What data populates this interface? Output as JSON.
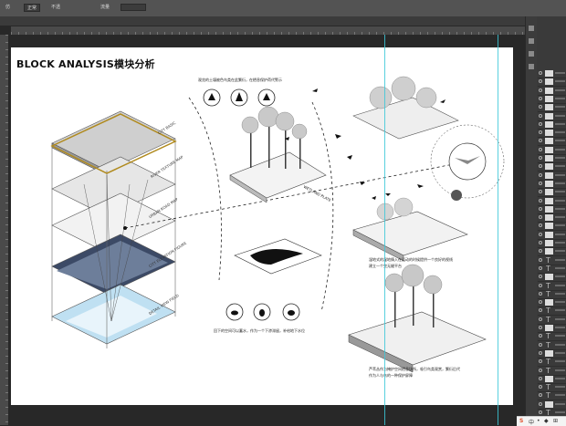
{
  "options_bar": {
    "left_label": "仿",
    "mode_value": "正常",
    "opacity_label": "不透",
    "flow_label": "流量"
  },
  "doc_tab": {
    "title": ""
  },
  "canvas": {
    "title": "BLOCK ANALYSIS模块分析",
    "layer_labels": [
      "CITY BASIC",
      "RIVER TEXTURE MAP",
      "URBAN ROAD MAP",
      "CITY ELEVATION FIGURE",
      "DETAIL VIEW FIELD"
    ],
    "captions": {
      "top": "观览的土壤被色鸟类在此繁衍，在栖息保护荷代警示",
      "wetland": "WETLAND PLATE",
      "middle_left": "回下的空间可以蓄水，作为一个下渗滞留，补给地下水位",
      "right_mid_1": "湿地式的湿地情入在运动的时候提供一个良好的视线",
      "right_mid_2": "建立一个完无缝平台",
      "right_bottom_1": "芦苇丛作为掩护空间栖息场所，吸引鸟类观赏，繁衍后代",
      "right_bottom_2": "作为人与鸟的一种保护屏障"
    }
  },
  "taskbar": {
    "items": [
      "S",
      "中",
      "•",
      "◆",
      "⊞"
    ]
  },
  "colors": {
    "guide": "#3cc8d8",
    "workspace": "#282828",
    "panel": "#3a3a3a"
  }
}
